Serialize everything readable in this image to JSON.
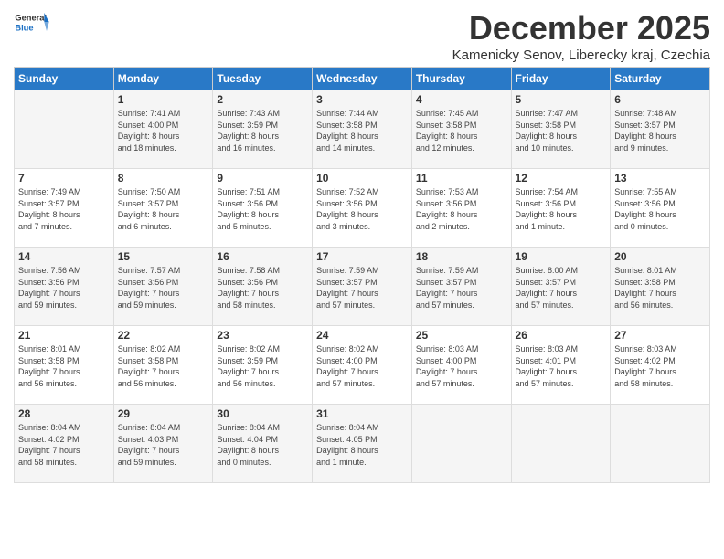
{
  "header": {
    "logo_line1": "General",
    "logo_line2": "Blue",
    "month": "December 2025",
    "location": "Kamenicky Senov, Liberecky kraj, Czechia"
  },
  "days_of_week": [
    "Sunday",
    "Monday",
    "Tuesday",
    "Wednesday",
    "Thursday",
    "Friday",
    "Saturday"
  ],
  "weeks": [
    [
      {
        "day": "",
        "info": ""
      },
      {
        "day": "1",
        "info": "Sunrise: 7:41 AM\nSunset: 4:00 PM\nDaylight: 8 hours\nand 18 minutes."
      },
      {
        "day": "2",
        "info": "Sunrise: 7:43 AM\nSunset: 3:59 PM\nDaylight: 8 hours\nand 16 minutes."
      },
      {
        "day": "3",
        "info": "Sunrise: 7:44 AM\nSunset: 3:58 PM\nDaylight: 8 hours\nand 14 minutes."
      },
      {
        "day": "4",
        "info": "Sunrise: 7:45 AM\nSunset: 3:58 PM\nDaylight: 8 hours\nand 12 minutes."
      },
      {
        "day": "5",
        "info": "Sunrise: 7:47 AM\nSunset: 3:58 PM\nDaylight: 8 hours\nand 10 minutes."
      },
      {
        "day": "6",
        "info": "Sunrise: 7:48 AM\nSunset: 3:57 PM\nDaylight: 8 hours\nand 9 minutes."
      }
    ],
    [
      {
        "day": "7",
        "info": "Sunrise: 7:49 AM\nSunset: 3:57 PM\nDaylight: 8 hours\nand 7 minutes."
      },
      {
        "day": "8",
        "info": "Sunrise: 7:50 AM\nSunset: 3:57 PM\nDaylight: 8 hours\nand 6 minutes."
      },
      {
        "day": "9",
        "info": "Sunrise: 7:51 AM\nSunset: 3:56 PM\nDaylight: 8 hours\nand 5 minutes."
      },
      {
        "day": "10",
        "info": "Sunrise: 7:52 AM\nSunset: 3:56 PM\nDaylight: 8 hours\nand 3 minutes."
      },
      {
        "day": "11",
        "info": "Sunrise: 7:53 AM\nSunset: 3:56 PM\nDaylight: 8 hours\nand 2 minutes."
      },
      {
        "day": "12",
        "info": "Sunrise: 7:54 AM\nSunset: 3:56 PM\nDaylight: 8 hours\nand 1 minute."
      },
      {
        "day": "13",
        "info": "Sunrise: 7:55 AM\nSunset: 3:56 PM\nDaylight: 8 hours\nand 0 minutes."
      }
    ],
    [
      {
        "day": "14",
        "info": "Sunrise: 7:56 AM\nSunset: 3:56 PM\nDaylight: 7 hours\nand 59 minutes."
      },
      {
        "day": "15",
        "info": "Sunrise: 7:57 AM\nSunset: 3:56 PM\nDaylight: 7 hours\nand 59 minutes."
      },
      {
        "day": "16",
        "info": "Sunrise: 7:58 AM\nSunset: 3:56 PM\nDaylight: 7 hours\nand 58 minutes."
      },
      {
        "day": "17",
        "info": "Sunrise: 7:59 AM\nSunset: 3:57 PM\nDaylight: 7 hours\nand 57 minutes."
      },
      {
        "day": "18",
        "info": "Sunrise: 7:59 AM\nSunset: 3:57 PM\nDaylight: 7 hours\nand 57 minutes."
      },
      {
        "day": "19",
        "info": "Sunrise: 8:00 AM\nSunset: 3:57 PM\nDaylight: 7 hours\nand 57 minutes."
      },
      {
        "day": "20",
        "info": "Sunrise: 8:01 AM\nSunset: 3:58 PM\nDaylight: 7 hours\nand 56 minutes."
      }
    ],
    [
      {
        "day": "21",
        "info": "Sunrise: 8:01 AM\nSunset: 3:58 PM\nDaylight: 7 hours\nand 56 minutes."
      },
      {
        "day": "22",
        "info": "Sunrise: 8:02 AM\nSunset: 3:58 PM\nDaylight: 7 hours\nand 56 minutes."
      },
      {
        "day": "23",
        "info": "Sunrise: 8:02 AM\nSunset: 3:59 PM\nDaylight: 7 hours\nand 56 minutes."
      },
      {
        "day": "24",
        "info": "Sunrise: 8:02 AM\nSunset: 4:00 PM\nDaylight: 7 hours\nand 57 minutes."
      },
      {
        "day": "25",
        "info": "Sunrise: 8:03 AM\nSunset: 4:00 PM\nDaylight: 7 hours\nand 57 minutes."
      },
      {
        "day": "26",
        "info": "Sunrise: 8:03 AM\nSunset: 4:01 PM\nDaylight: 7 hours\nand 57 minutes."
      },
      {
        "day": "27",
        "info": "Sunrise: 8:03 AM\nSunset: 4:02 PM\nDaylight: 7 hours\nand 58 minutes."
      }
    ],
    [
      {
        "day": "28",
        "info": "Sunrise: 8:04 AM\nSunset: 4:02 PM\nDaylight: 7 hours\nand 58 minutes."
      },
      {
        "day": "29",
        "info": "Sunrise: 8:04 AM\nSunset: 4:03 PM\nDaylight: 7 hours\nand 59 minutes."
      },
      {
        "day": "30",
        "info": "Sunrise: 8:04 AM\nSunset: 4:04 PM\nDaylight: 8 hours\nand 0 minutes."
      },
      {
        "day": "31",
        "info": "Sunrise: 8:04 AM\nSunset: 4:05 PM\nDaylight: 8 hours\nand 1 minute."
      },
      {
        "day": "",
        "info": ""
      },
      {
        "day": "",
        "info": ""
      },
      {
        "day": "",
        "info": ""
      }
    ]
  ]
}
